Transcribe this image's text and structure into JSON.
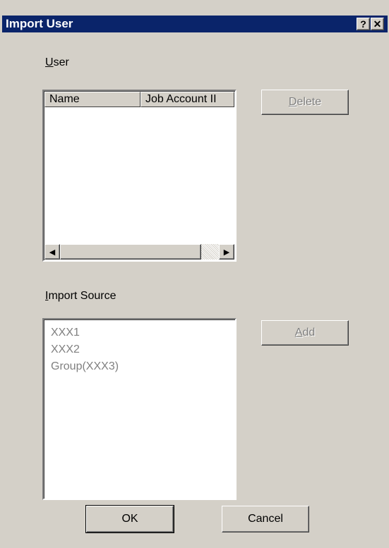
{
  "dialog": {
    "title": "Import User",
    "help_glyph": "?",
    "close_glyph": "✕"
  },
  "user_section": {
    "label_accel": "U",
    "label_rest": "ser",
    "columns": [
      "Name",
      "Job Account II"
    ],
    "rows": [],
    "scroll_left_glyph": "◀",
    "scroll_right_glyph": "▶"
  },
  "import_source": {
    "label_accel": "I",
    "label_rest": "mport Source",
    "items": [
      "XXX1",
      "XXX2",
      "Group(XXX3)"
    ]
  },
  "buttons": {
    "delete_accel": "D",
    "delete_rest": "elete",
    "add_accel": "A",
    "add_rest": "dd",
    "ok": "OK",
    "cancel": "Cancel"
  }
}
